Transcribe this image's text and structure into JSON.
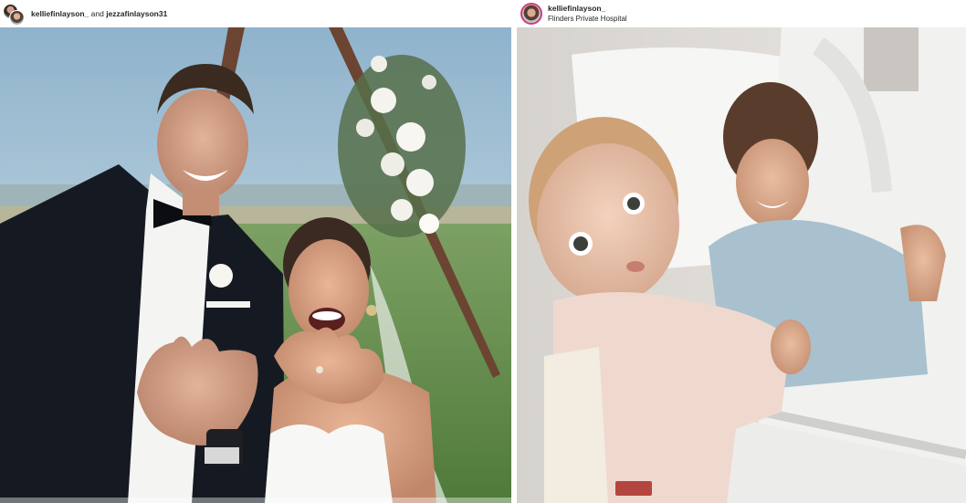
{
  "left_post": {
    "username_1": "kelliefinlayson_",
    "connector": " and ",
    "username_2": "jezzafinlayson31",
    "photo_icon": "wedding-photo"
  },
  "right_post": {
    "username": "kelliefinlayson_",
    "location": "Flinders Private Hospital",
    "photo_icon": "hospital-photo"
  },
  "colors": {
    "story_ring": "#d9397d",
    "username_text": "#262626"
  }
}
